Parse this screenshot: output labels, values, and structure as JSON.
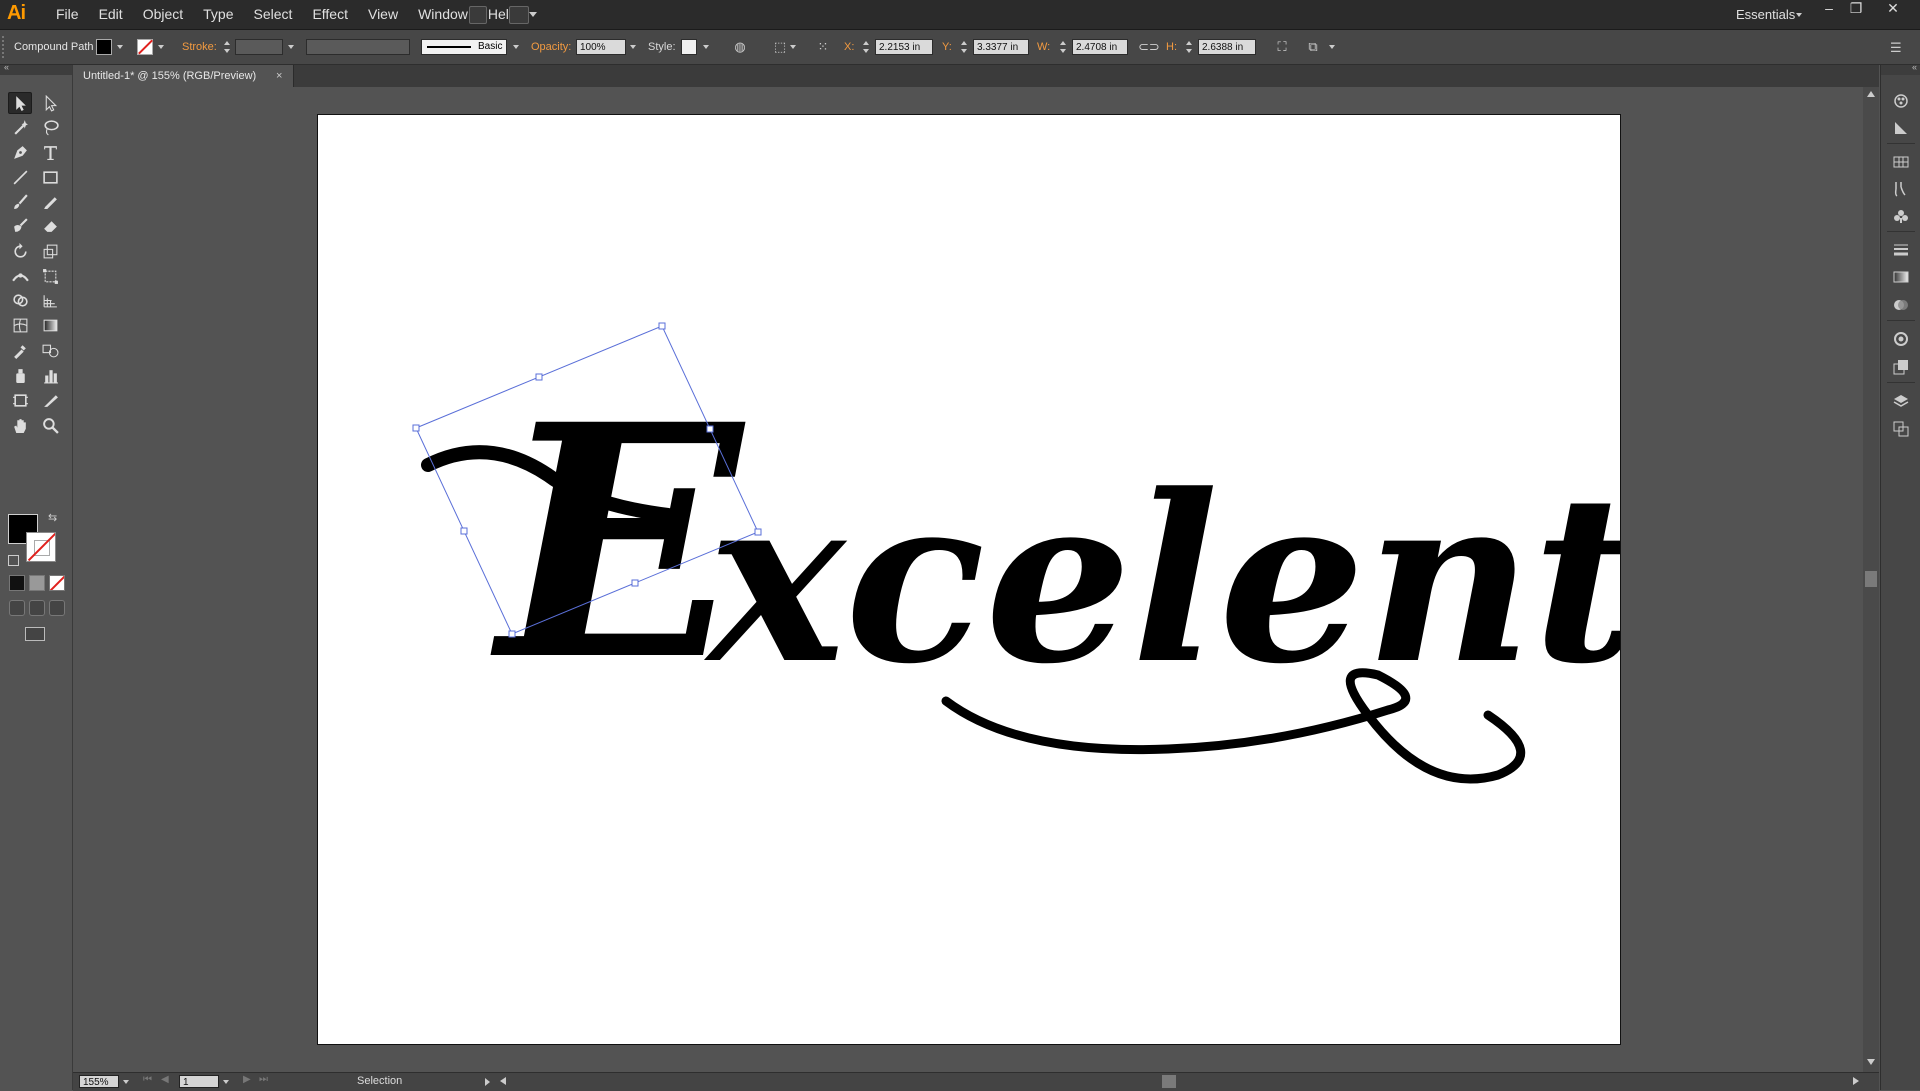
{
  "app": {
    "logo": "Ai",
    "menu": [
      "File",
      "Edit",
      "Object",
      "Type",
      "Select",
      "Effect",
      "View",
      "Window",
      "Help"
    ],
    "workspace": "Essentials",
    "window_controls": {
      "minimize": "–",
      "restore": "❐",
      "close": "✕"
    }
  },
  "control_bar": {
    "selection_type": "Compound Path",
    "stroke_label": "Stroke:",
    "brush_label": "Basic",
    "opacity_label": "Opacity:",
    "opacity_value": "100%",
    "style_label": "Style:",
    "x_label": "X:",
    "x_value": "2.2153 in",
    "y_label": "Y:",
    "y_value": "3.3377 in",
    "w_label": "W:",
    "w_value": "2.4708 in",
    "h_label": "H:",
    "h_value": "2.6388 in"
  },
  "document": {
    "tab_title": "Untitled-1* @ 155% (RGB/Preview)",
    "close": "×",
    "lettering_text": "Excelente"
  },
  "status_bar": {
    "zoom": "155%",
    "artboard_number": "1",
    "status": "Selection"
  },
  "colors": {
    "fill": "#000000",
    "selection_bounding_box": "#5a6fd8",
    "accent_label": "#f29a40",
    "logo": "#ff9a00"
  },
  "icons": {
    "tools": [
      "selection-tool-icon",
      "direct-selection-tool-icon",
      "magic-wand-tool-icon",
      "lasso-tool-icon",
      "pen-tool-icon",
      "type-tool-icon",
      "line-segment-tool-icon",
      "rectangle-tool-icon",
      "paintbrush-tool-icon",
      "pencil-tool-icon",
      "blob-brush-tool-icon",
      "eraser-tool-icon",
      "rotate-tool-icon",
      "scale-tool-icon",
      "width-tool-icon",
      "free-transform-tool-icon",
      "shape-builder-tool-icon",
      "perspective-grid-tool-icon",
      "mesh-tool-icon",
      "gradient-tool-icon",
      "eyedropper-tool-icon",
      "blend-tool-icon",
      "symbol-sprayer-tool-icon",
      "column-graph-tool-icon",
      "artboard-tool-icon",
      "slice-tool-icon",
      "hand-tool-icon",
      "zoom-tool-icon"
    ],
    "dock": [
      "color-icon",
      "color-guide-icon",
      "swatches-icon",
      "brushes-icon",
      "symbols-icon",
      "stroke-icon",
      "gradient-icon",
      "transparency-icon",
      "appearance-icon",
      "graphic-styles-icon",
      "layers-icon",
      "artboards-icon"
    ]
  }
}
